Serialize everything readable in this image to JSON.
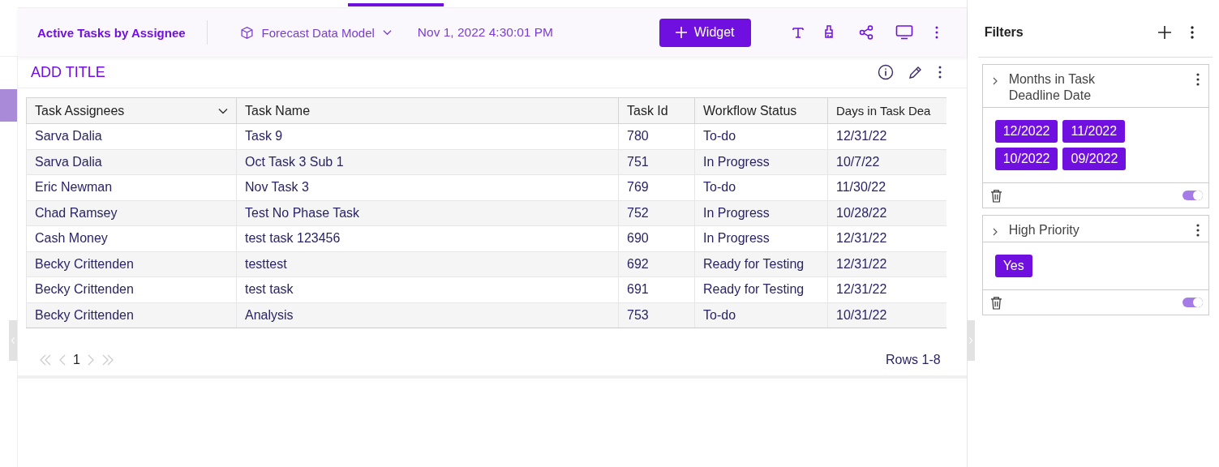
{
  "header": {
    "title": "Active Tasks by Assignee",
    "data_model": "Forecast Data Model",
    "timestamp": "Nov 1, 2022 4:30:01 PM",
    "widget_button": "Widget"
  },
  "widget": {
    "title": "ADD TITLE"
  },
  "table": {
    "columns": [
      "Task Assignees",
      "Task Name",
      "Task Id",
      "Workflow Status",
      "Days in Task Dea"
    ],
    "rows": [
      [
        "Sarva Dalia",
        "Task 9",
        "780",
        "To-do",
        "12/31/22"
      ],
      [
        "Sarva Dalia",
        "Oct Task 3 Sub 1",
        "751",
        "In Progress",
        "10/7/22"
      ],
      [
        "Eric Newman",
        "Nov Task 3",
        "769",
        "To-do",
        "11/30/22"
      ],
      [
        "Chad Ramsey",
        "Test No Phase Task",
        "752",
        "In Progress",
        "10/28/22"
      ],
      [
        "Cash Money",
        "test task 123456",
        "690",
        "In Progress",
        "12/31/22"
      ],
      [
        "Becky Crittenden",
        "testtest",
        "692",
        "Ready for Testing",
        "12/31/22"
      ],
      [
        "Becky Crittenden",
        "test task",
        "691",
        "Ready for Testing",
        "12/31/22"
      ],
      [
        "Becky Crittenden",
        "Analysis",
        "753",
        "To-do",
        "10/31/22"
      ]
    ]
  },
  "pagination": {
    "page": "1",
    "rows_label": "Rows 1-8"
  },
  "filters": {
    "title": "Filters",
    "items": [
      {
        "name": "Months in Task Deadline Date",
        "values": [
          "12/2022",
          "11/2022",
          "10/2022",
          "09/2022"
        ],
        "on": true
      },
      {
        "name": "High Priority",
        "values": [
          "Yes"
        ],
        "on": true
      }
    ]
  }
}
